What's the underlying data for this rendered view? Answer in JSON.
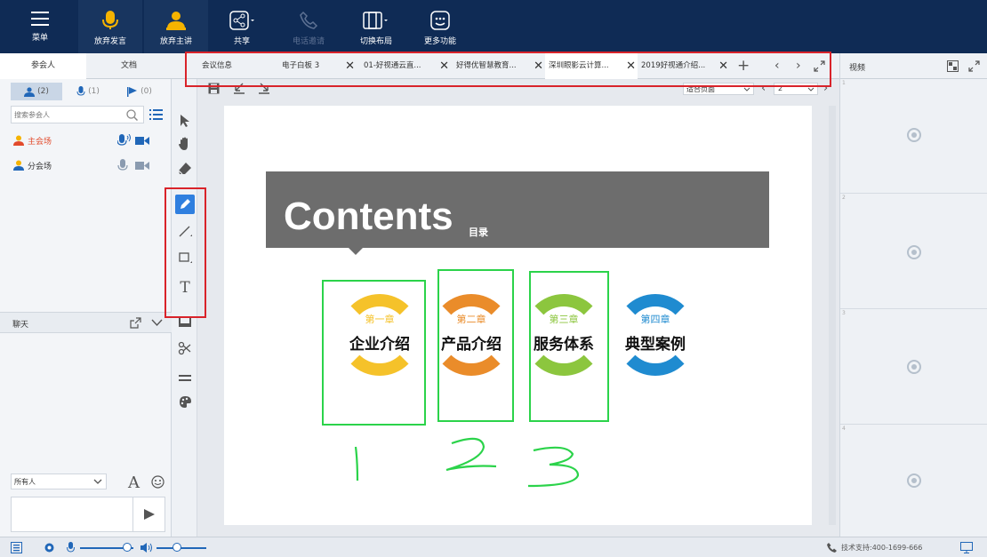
{
  "topbar": {
    "menu_label": "菜单",
    "give_up_speak_label": "放弃发言",
    "give_up_host_label": "放弃主讲",
    "share_label": "共享",
    "phone_invite_label": "电话邀请",
    "switch_layout_label": "切换布局",
    "more_label": "更多功能"
  },
  "left": {
    "tab_participants": "参会人",
    "tab_docs": "文档",
    "filter_all_count": "(2)",
    "filter_mic_count": "(1)",
    "filter_video_count": "(0)",
    "search_placeholder": "搜索参会人",
    "participants": [
      {
        "name": "主会场",
        "color": "#e24a2b"
      },
      {
        "name": "分会场",
        "color": "#333333"
      }
    ],
    "chat_title": "聊天",
    "chat_recipient": "所有人"
  },
  "doc_tabs": {
    "items": [
      {
        "label": "会议信息",
        "closable": false
      },
      {
        "label": "电子白板 3",
        "closable": true
      },
      {
        "label": "01-好视通云直...",
        "closable": true
      },
      {
        "label": "好得优智慧教育...",
        "closable": true
      },
      {
        "label": "深圳眼影云计算...",
        "closable": true,
        "active": true
      },
      {
        "label": "2019好视通介绍...",
        "closable": true
      }
    ],
    "add_label": "+"
  },
  "doc_toolbar": {
    "fit_option": "适合页面",
    "page_value": "2"
  },
  "slide": {
    "title": "Contents",
    "subtitle": "目录",
    "chapters": [
      {
        "num": "第一章",
        "name": "企业介绍",
        "color": "#f5c22a"
      },
      {
        "num": "第二章",
        "name": "产品介绍",
        "color": "#ea8c2a"
      },
      {
        "num": "第三章",
        "name": "服务体系",
        "color": "#8cc63e"
      },
      {
        "num": "第四章",
        "name": "典型案例",
        "color": "#1f8bd0"
      }
    ],
    "annotations": [
      "1",
      "2",
      "3"
    ]
  },
  "right": {
    "title": "视频",
    "slots": [
      "1",
      "2",
      "3",
      "4"
    ]
  },
  "status": {
    "support_text": "技术支持:400-1699-666"
  },
  "colors": {
    "topbar": "#0f2b55",
    "highlight_red": "#d9232a",
    "annotation_green": "#2bd34a",
    "slide_banner": "#6d6d6d"
  }
}
